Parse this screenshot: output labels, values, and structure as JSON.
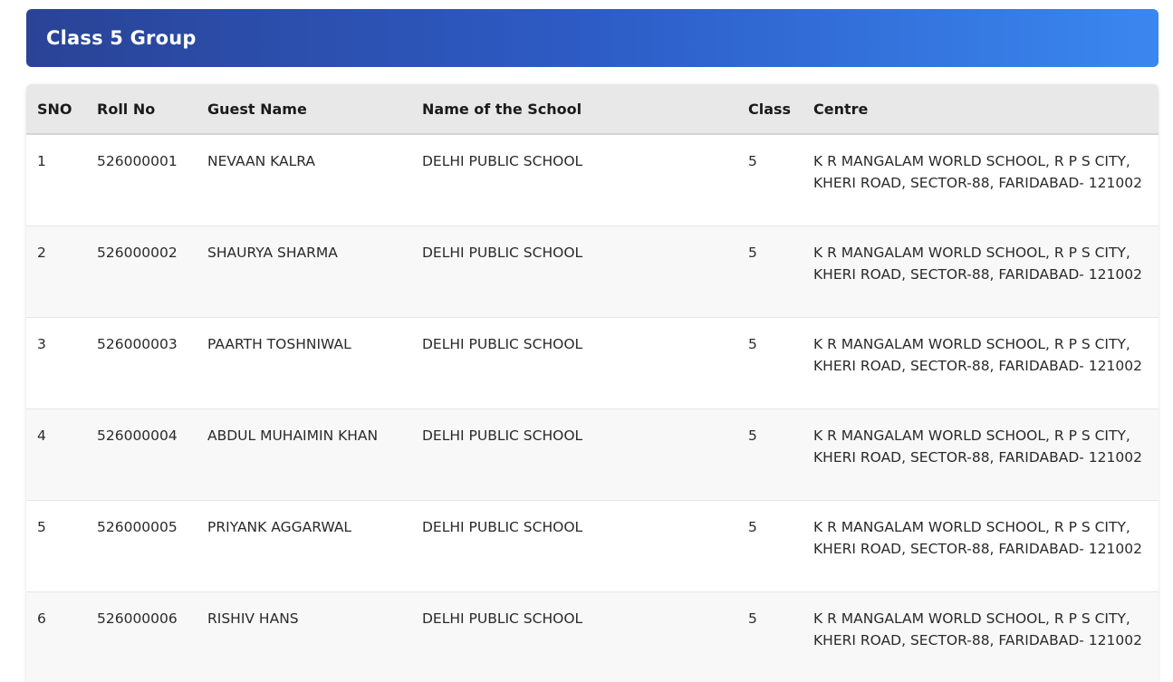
{
  "group": {
    "title": "Class 5 Group"
  },
  "table": {
    "headers": {
      "sno": "SNO",
      "roll_no": "Roll No",
      "guest_name": "Guest Name",
      "school": "Name of the School",
      "class": "Class",
      "centre": "Centre"
    },
    "rows": [
      {
        "sno": "1",
        "roll_no": "526000001",
        "guest_name": "NEVAAN KALRA",
        "school": "DELHI PUBLIC SCHOOL",
        "class": "5",
        "centre": "K R MANGALAM WORLD SCHOOL, R P S CITY, KHERI ROAD, SECTOR-88, FARIDABAD- 121002"
      },
      {
        "sno": "2",
        "roll_no": "526000002",
        "guest_name": "SHAURYA SHARMA",
        "school": "DELHI PUBLIC SCHOOL",
        "class": "5",
        "centre": "K R MANGALAM WORLD SCHOOL, R P S CITY, KHERI ROAD, SECTOR-88, FARIDABAD- 121002"
      },
      {
        "sno": "3",
        "roll_no": "526000003",
        "guest_name": "PAARTH TOSHNIWAL",
        "school": "DELHI PUBLIC SCHOOL",
        "class": "5",
        "centre": "K R MANGALAM WORLD SCHOOL, R P S CITY, KHERI ROAD, SECTOR-88, FARIDABAD- 121002"
      },
      {
        "sno": "4",
        "roll_no": "526000004",
        "guest_name": "ABDUL MUHAIMIN KHAN",
        "school": "DELHI PUBLIC SCHOOL",
        "class": "5",
        "centre": "K R MANGALAM WORLD SCHOOL, R P S CITY, KHERI ROAD, SECTOR-88, FARIDABAD- 121002"
      },
      {
        "sno": "5",
        "roll_no": "526000005",
        "guest_name": "PRIYANK AGGARWAL",
        "school": "DELHI PUBLIC SCHOOL",
        "class": "5",
        "centre": "K R MANGALAM WORLD SCHOOL, R P S CITY, KHERI ROAD, SECTOR-88, FARIDABAD- 121002"
      },
      {
        "sno": "6",
        "roll_no": "526000006",
        "guest_name": "RISHIV HANS",
        "school": "DELHI PUBLIC SCHOOL",
        "class": "5",
        "centre": "K R MANGALAM WORLD SCHOOL, R P S CITY, KHERI ROAD, SECTOR-88, FARIDABAD- 121002"
      }
    ]
  },
  "colors": {
    "header_gradient_start": "#2a4396",
    "header_gradient_end": "#3a87f0",
    "table_header_bg": "#e8e8e8",
    "row_alt_bg": "#f8f8f8"
  }
}
